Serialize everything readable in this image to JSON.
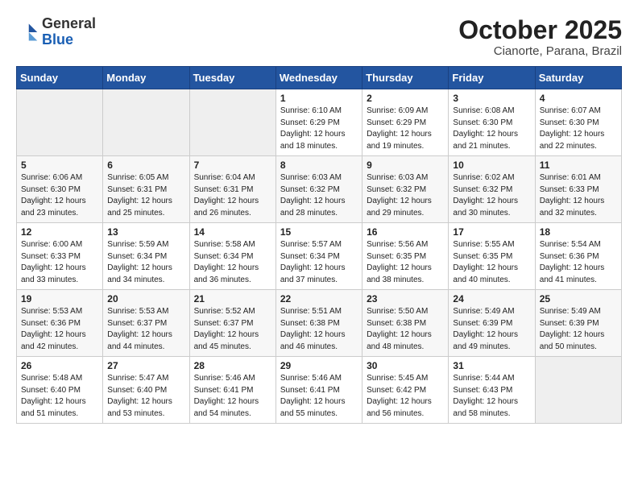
{
  "header": {
    "logo_line1": "General",
    "logo_line2": "Blue",
    "month": "October 2025",
    "location": "Cianorte, Parana, Brazil"
  },
  "weekdays": [
    "Sunday",
    "Monday",
    "Tuesday",
    "Wednesday",
    "Thursday",
    "Friday",
    "Saturday"
  ],
  "weeks": [
    [
      {
        "day": "",
        "text": ""
      },
      {
        "day": "",
        "text": ""
      },
      {
        "day": "",
        "text": ""
      },
      {
        "day": "1",
        "text": "Sunrise: 6:10 AM\nSunset: 6:29 PM\nDaylight: 12 hours\nand 18 minutes."
      },
      {
        "day": "2",
        "text": "Sunrise: 6:09 AM\nSunset: 6:29 PM\nDaylight: 12 hours\nand 19 minutes."
      },
      {
        "day": "3",
        "text": "Sunrise: 6:08 AM\nSunset: 6:30 PM\nDaylight: 12 hours\nand 21 minutes."
      },
      {
        "day": "4",
        "text": "Sunrise: 6:07 AM\nSunset: 6:30 PM\nDaylight: 12 hours\nand 22 minutes."
      }
    ],
    [
      {
        "day": "5",
        "text": "Sunrise: 6:06 AM\nSunset: 6:30 PM\nDaylight: 12 hours\nand 23 minutes."
      },
      {
        "day": "6",
        "text": "Sunrise: 6:05 AM\nSunset: 6:31 PM\nDaylight: 12 hours\nand 25 minutes."
      },
      {
        "day": "7",
        "text": "Sunrise: 6:04 AM\nSunset: 6:31 PM\nDaylight: 12 hours\nand 26 minutes."
      },
      {
        "day": "8",
        "text": "Sunrise: 6:03 AM\nSunset: 6:32 PM\nDaylight: 12 hours\nand 28 minutes."
      },
      {
        "day": "9",
        "text": "Sunrise: 6:03 AM\nSunset: 6:32 PM\nDaylight: 12 hours\nand 29 minutes."
      },
      {
        "day": "10",
        "text": "Sunrise: 6:02 AM\nSunset: 6:32 PM\nDaylight: 12 hours\nand 30 minutes."
      },
      {
        "day": "11",
        "text": "Sunrise: 6:01 AM\nSunset: 6:33 PM\nDaylight: 12 hours\nand 32 minutes."
      }
    ],
    [
      {
        "day": "12",
        "text": "Sunrise: 6:00 AM\nSunset: 6:33 PM\nDaylight: 12 hours\nand 33 minutes."
      },
      {
        "day": "13",
        "text": "Sunrise: 5:59 AM\nSunset: 6:34 PM\nDaylight: 12 hours\nand 34 minutes."
      },
      {
        "day": "14",
        "text": "Sunrise: 5:58 AM\nSunset: 6:34 PM\nDaylight: 12 hours\nand 36 minutes."
      },
      {
        "day": "15",
        "text": "Sunrise: 5:57 AM\nSunset: 6:34 PM\nDaylight: 12 hours\nand 37 minutes."
      },
      {
        "day": "16",
        "text": "Sunrise: 5:56 AM\nSunset: 6:35 PM\nDaylight: 12 hours\nand 38 minutes."
      },
      {
        "day": "17",
        "text": "Sunrise: 5:55 AM\nSunset: 6:35 PM\nDaylight: 12 hours\nand 40 minutes."
      },
      {
        "day": "18",
        "text": "Sunrise: 5:54 AM\nSunset: 6:36 PM\nDaylight: 12 hours\nand 41 minutes."
      }
    ],
    [
      {
        "day": "19",
        "text": "Sunrise: 5:53 AM\nSunset: 6:36 PM\nDaylight: 12 hours\nand 42 minutes."
      },
      {
        "day": "20",
        "text": "Sunrise: 5:53 AM\nSunset: 6:37 PM\nDaylight: 12 hours\nand 44 minutes."
      },
      {
        "day": "21",
        "text": "Sunrise: 5:52 AM\nSunset: 6:37 PM\nDaylight: 12 hours\nand 45 minutes."
      },
      {
        "day": "22",
        "text": "Sunrise: 5:51 AM\nSunset: 6:38 PM\nDaylight: 12 hours\nand 46 minutes."
      },
      {
        "day": "23",
        "text": "Sunrise: 5:50 AM\nSunset: 6:38 PM\nDaylight: 12 hours\nand 48 minutes."
      },
      {
        "day": "24",
        "text": "Sunrise: 5:49 AM\nSunset: 6:39 PM\nDaylight: 12 hours\nand 49 minutes."
      },
      {
        "day": "25",
        "text": "Sunrise: 5:49 AM\nSunset: 6:39 PM\nDaylight: 12 hours\nand 50 minutes."
      }
    ],
    [
      {
        "day": "26",
        "text": "Sunrise: 5:48 AM\nSunset: 6:40 PM\nDaylight: 12 hours\nand 51 minutes."
      },
      {
        "day": "27",
        "text": "Sunrise: 5:47 AM\nSunset: 6:40 PM\nDaylight: 12 hours\nand 53 minutes."
      },
      {
        "day": "28",
        "text": "Sunrise: 5:46 AM\nSunset: 6:41 PM\nDaylight: 12 hours\nand 54 minutes."
      },
      {
        "day": "29",
        "text": "Sunrise: 5:46 AM\nSunset: 6:41 PM\nDaylight: 12 hours\nand 55 minutes."
      },
      {
        "day": "30",
        "text": "Sunrise: 5:45 AM\nSunset: 6:42 PM\nDaylight: 12 hours\nand 56 minutes."
      },
      {
        "day": "31",
        "text": "Sunrise: 5:44 AM\nSunset: 6:43 PM\nDaylight: 12 hours\nand 58 minutes."
      },
      {
        "day": "",
        "text": ""
      }
    ]
  ]
}
